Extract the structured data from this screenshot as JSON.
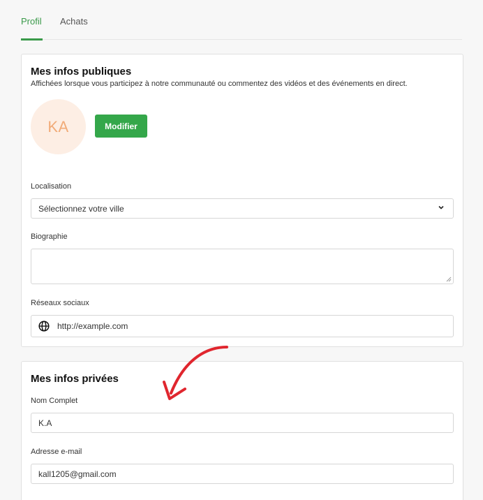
{
  "tabs": [
    {
      "label": "Profil",
      "active": true
    },
    {
      "label": "Achats",
      "active": false
    }
  ],
  "public_info": {
    "title": "Mes infos publiques",
    "subtitle": "Affichées lorsque vous participez à notre communauté ou commentez des vidéos et des événements en direct.",
    "avatar_initials": "KA",
    "edit_button": "Modifier",
    "location": {
      "label": "Localisation",
      "value": "Sélectionnez votre ville"
    },
    "biography": {
      "label": "Biographie",
      "value": ""
    },
    "social": {
      "label": "Réseaux sociaux",
      "value": "http://example.com"
    }
  },
  "private_info": {
    "title": "Mes infos privées",
    "full_name": {
      "label": "Nom Complet",
      "value": "K.A"
    },
    "email": {
      "label": "Adresse e-mail",
      "value": "kall1205@gmail.com"
    }
  },
  "colors": {
    "accent": "#3a9a4a",
    "button": "#34a74a",
    "avatar_bg": "#fdeee4",
    "avatar_text": "#f1ab78",
    "annotation_arrow": "#e0262e"
  },
  "icons": [
    "chevron-down-icon",
    "globe-icon",
    "resize-grip-icon",
    "annotation-arrow"
  ]
}
